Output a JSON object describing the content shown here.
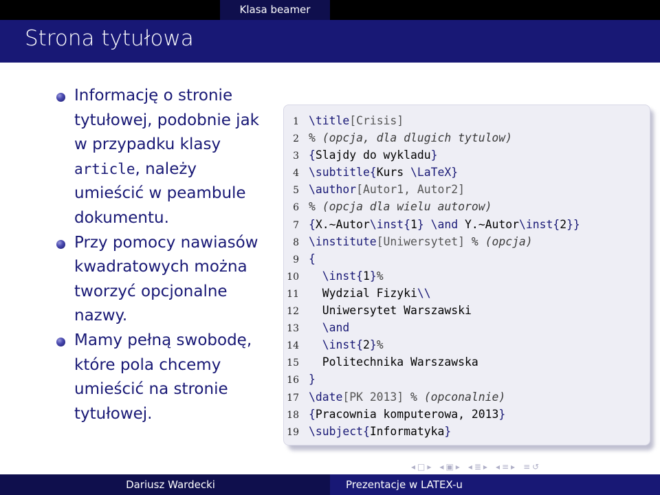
{
  "header": {
    "section": "Klasa beamer"
  },
  "frame": {
    "title": "Strona tytułowa"
  },
  "bullets": [
    {
      "text_before": "Informację o stronie tytułowej, podobnie jak w przypadku klasy ",
      "mono": "article",
      "text_after": ", należy umieścić w peambule dokumentu."
    },
    {
      "text_before": "Przy pomocy nawiasów kwadratowych można tworzyć opcjonalne nazwy.",
      "mono": "",
      "text_after": ""
    },
    {
      "text_before": "Mamy pełną swobodę, które pola chcemy umieścić na stronie tytułowej.",
      "mono": "",
      "text_after": ""
    }
  ],
  "code": {
    "lines": [
      {
        "n": "1",
        "parts": [
          [
            "cmd",
            "\\title"
          ],
          [
            "opt",
            "[Crisis]"
          ]
        ]
      },
      {
        "n": "2",
        "parts": [
          [
            "cmt",
            "% (opcja, dla dlugich tytulow)"
          ]
        ]
      },
      {
        "n": "3",
        "parts": [
          [
            "cmd",
            "{"
          ],
          [
            "",
            "Slajdy do wykladu"
          ],
          [
            "cmd",
            "}"
          ]
        ]
      },
      {
        "n": "4",
        "parts": [
          [
            "cmd",
            "\\subtitle{"
          ],
          [
            "",
            "Kurs "
          ],
          [
            "cmd",
            "\\LaTeX}"
          ]
        ]
      },
      {
        "n": "5",
        "parts": [
          [
            "cmd",
            "\\author"
          ],
          [
            "opt",
            "[Autor1, Autor2]"
          ]
        ]
      },
      {
        "n": "6",
        "parts": [
          [
            "cmt",
            "% (opcja dla wielu autorow)"
          ]
        ]
      },
      {
        "n": "7",
        "parts": [
          [
            "cmd",
            "{"
          ],
          [
            "",
            "X.~Autor"
          ],
          [
            "cmd",
            "\\inst{"
          ],
          [
            "",
            "1"
          ],
          [
            "cmd",
            "}"
          ],
          [
            "",
            " "
          ],
          [
            "cmd",
            "\\and"
          ],
          [
            "",
            " Y.~Autor"
          ],
          [
            "cmd",
            "\\inst{"
          ],
          [
            "",
            "2"
          ],
          [
            "cmd",
            "}}"
          ]
        ]
      },
      {
        "n": "8",
        "parts": [
          [
            "cmd",
            "\\institute"
          ],
          [
            "opt",
            "[Uniwersytet]"
          ],
          [
            "",
            " "
          ],
          [
            "cmt",
            "% (opcja)"
          ]
        ]
      },
      {
        "n": "9",
        "parts": [
          [
            "cmd",
            "{"
          ]
        ]
      },
      {
        "n": "10",
        "parts": [
          [
            "",
            "  "
          ],
          [
            "cmd",
            "\\inst{"
          ],
          [
            "",
            "1"
          ],
          [
            "cmd",
            "}"
          ],
          [
            "cmt",
            "%"
          ]
        ]
      },
      {
        "n": "11",
        "parts": [
          [
            "",
            "  Wydzial Fizyki"
          ],
          [
            "cmd",
            "\\\\"
          ]
        ]
      },
      {
        "n": "12",
        "parts": [
          [
            "",
            "  Uniwersytet Warszawski"
          ]
        ]
      },
      {
        "n": "13",
        "parts": [
          [
            "",
            "  "
          ],
          [
            "cmd",
            "\\and"
          ]
        ]
      },
      {
        "n": "14",
        "parts": [
          [
            "",
            "  "
          ],
          [
            "cmd",
            "\\inst{"
          ],
          [
            "",
            "2"
          ],
          [
            "cmd",
            "}"
          ],
          [
            "cmt",
            "%"
          ]
        ]
      },
      {
        "n": "15",
        "parts": [
          [
            "",
            "  Politechnika Warszawska"
          ]
        ]
      },
      {
        "n": "16",
        "parts": [
          [
            "cmd",
            "}"
          ]
        ]
      },
      {
        "n": "17",
        "parts": [
          [
            "cmd",
            "\\date"
          ],
          [
            "opt",
            "[PK 2013]"
          ],
          [
            "",
            " "
          ],
          [
            "cmt",
            "% (opconalnie)"
          ]
        ]
      },
      {
        "n": "18",
        "parts": [
          [
            "cmd",
            "{"
          ],
          [
            "",
            "Pracownia komputerowa, 2013"
          ],
          [
            "cmd",
            "}"
          ]
        ]
      },
      {
        "n": "19",
        "parts": [
          [
            "cmd",
            "\\subject{"
          ],
          [
            "",
            "Informatyka"
          ],
          [
            "cmd",
            "}"
          ]
        ]
      }
    ]
  },
  "nav": {
    "icons": [
      "nav-prev-frame-icon",
      "nav-frame-icon",
      "nav-next-frame-icon",
      "nav-prev-subsection-icon",
      "nav-subsection-icon",
      "nav-next-subsection-icon",
      "nav-prev-section-icon",
      "nav-section-icon",
      "nav-next-section-icon",
      "nav-prev-page-icon",
      "nav-page-icon",
      "nav-next-page-icon",
      "nav-appendix-icon",
      "nav-search-icon"
    ]
  },
  "footer": {
    "author": "Dariusz Wardecki",
    "title": "Prezentacje w LATEX-u"
  }
}
